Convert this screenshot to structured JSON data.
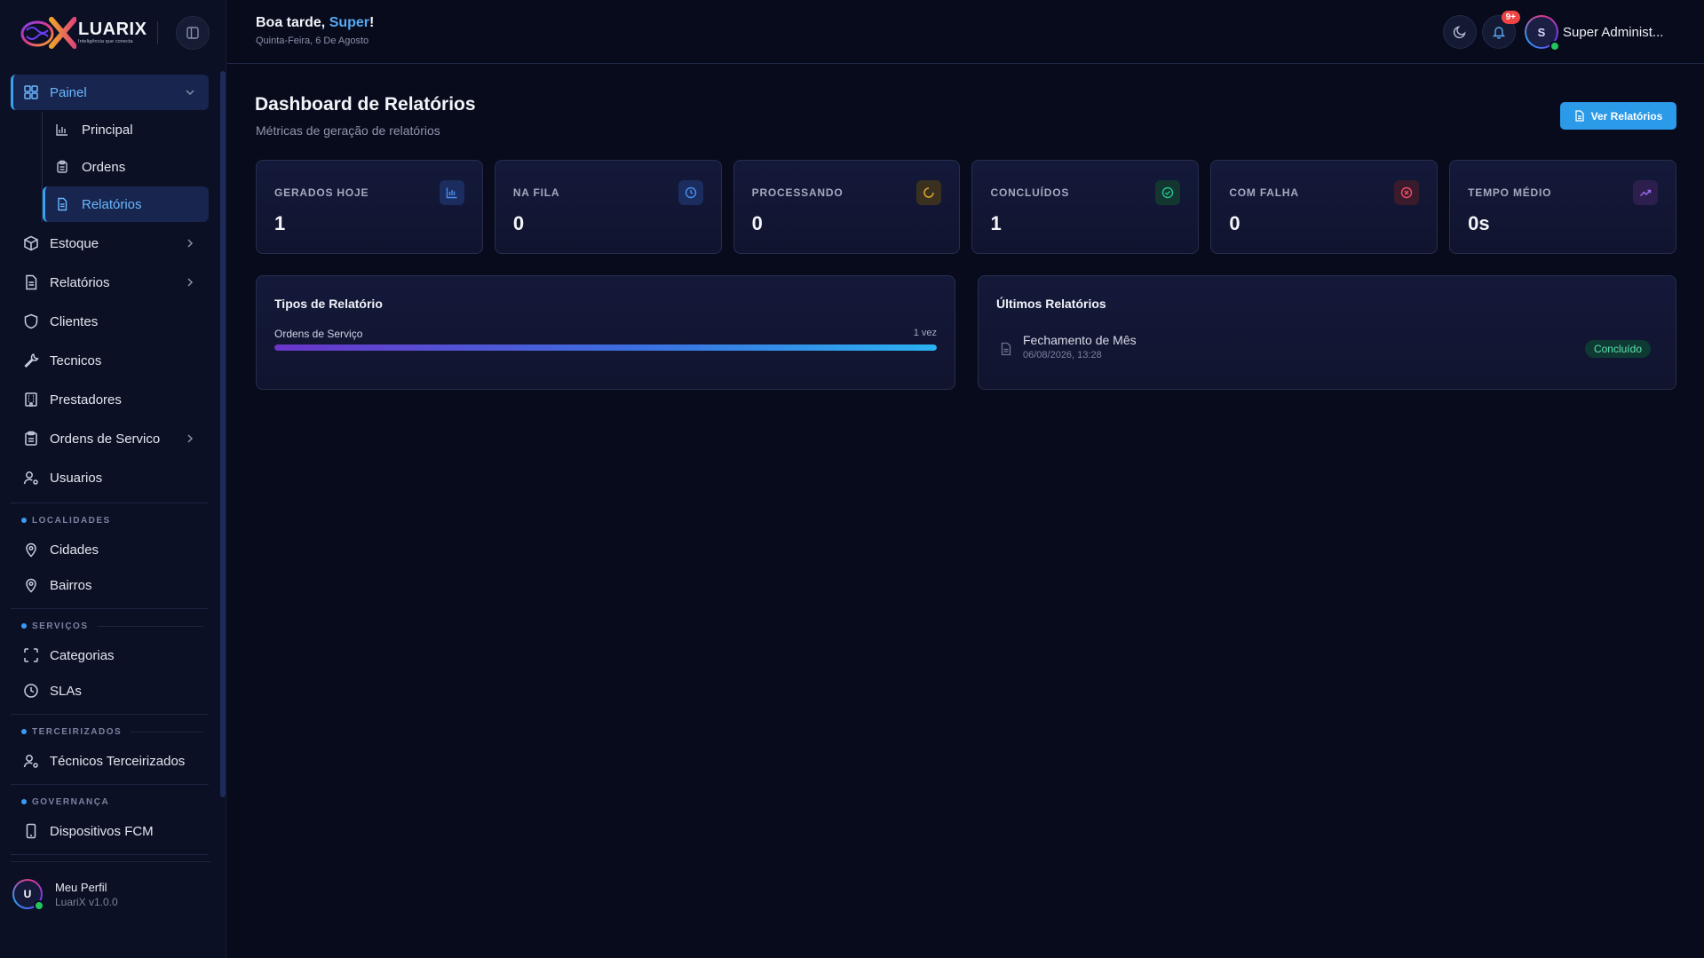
{
  "brand": {
    "name": "LUARIX",
    "tagline": "Inteligência que conecta"
  },
  "sidebar": {
    "nav": [
      {
        "label": "Painel",
        "icon": "grid-icon",
        "expanded": true
      },
      {
        "label": "Estoque",
        "icon": "package-icon"
      },
      {
        "label": "Relatórios",
        "icon": "file-icon"
      },
      {
        "label": "Clientes",
        "icon": "shield-icon"
      },
      {
        "label": "Tecnicos",
        "icon": "wrench-icon"
      },
      {
        "label": "Prestadores",
        "icon": "building-icon"
      },
      {
        "label": "Ordens de Servico",
        "icon": "clipboard-icon"
      },
      {
        "label": "Usuarios",
        "icon": "user-gear-icon"
      }
    ],
    "painel_sub": [
      {
        "label": "Principal",
        "icon": "bar-chart-icon"
      },
      {
        "label": "Ordens",
        "icon": "clipboard-icon"
      },
      {
        "label": "Relatórios",
        "icon": "file-icon",
        "active": true
      }
    ],
    "sections": {
      "localidades": {
        "title": "LOCALIDADES",
        "items": [
          "Cidades",
          "Bairros"
        ]
      },
      "servicos": {
        "title": "SERVIÇOS",
        "items": [
          "Categorias",
          "SLAs"
        ]
      },
      "terceirizados": {
        "title": "TERCEIRIZADOS",
        "items": [
          "Técnicos Terceirizados"
        ]
      },
      "governanca": {
        "title": "GOVERNANÇA",
        "items": [
          "Dispositivos FCM"
        ]
      }
    },
    "profile": {
      "initial": "U",
      "name": "Meu Perfil",
      "version": "LuariX v1.0.0"
    }
  },
  "header": {
    "greeting_prefix": "Boa tarde, ",
    "greeting_name": "Super",
    "greeting_suffix": "!",
    "date": "Quinta-Feira, 6 De Agosto",
    "notifications_badge": "9+",
    "user_initial": "S",
    "user_name": "Super Administ..."
  },
  "page": {
    "title": "Dashboard de Relatórios",
    "subtitle": "Métricas de geração de relatórios",
    "primary_button": "Ver Relatórios"
  },
  "stats": [
    {
      "label": "GERADOS HOJE",
      "value": "1",
      "icon": "bar-chart-icon",
      "color": "#4a8ff0"
    },
    {
      "label": "NA FILA",
      "value": "0",
      "icon": "clock-icon",
      "color": "#4a8ff0"
    },
    {
      "label": "PROCESSANDO",
      "value": "0",
      "icon": "spinner-icon",
      "color": "#e0a431"
    },
    {
      "label": "CONCLUÍDOS",
      "value": "1",
      "icon": "check-circle-icon",
      "color": "#22c58b"
    },
    {
      "label": "COM FALHA",
      "value": "0",
      "icon": "x-circle-icon",
      "color": "#ef4c6a"
    },
    {
      "label": "TEMPO MÉDIO",
      "value": "0s",
      "icon": "trending-up-icon",
      "color": "#9b6cf2"
    }
  ],
  "tipos": {
    "title": "Tipos de Relatório",
    "items": [
      {
        "label": "Ordens de Serviço",
        "count": "1 vez",
        "fraction": 1.0
      }
    ]
  },
  "ultimos": {
    "title": "Últimos Relatórios",
    "items": [
      {
        "name": "Fechamento de Mês",
        "date": "06/08/2026, 13:28",
        "status": "Concluído"
      }
    ]
  },
  "colors": {
    "accent": "#2b9ae8",
    "background": "#070b1c",
    "sidebar": "#0b1024",
    "success": "#22c55e",
    "danger": "#ef4444"
  }
}
